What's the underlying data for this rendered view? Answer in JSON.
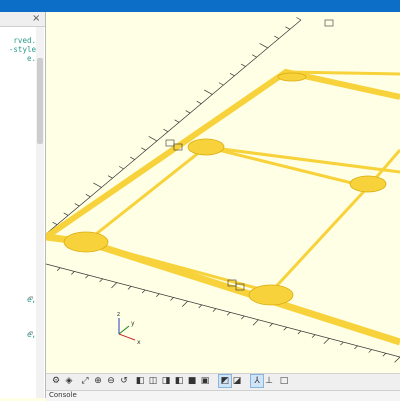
{
  "editor": {
    "close_glyph": "×",
    "lines": [
      {
        "text": "rved."
      },
      {
        "text": "-style"
      },
      {
        "text": "e."
      },
      {
        "text": "e,"
      },
      {
        "text": "e,"
      }
    ],
    "gutter_marks": [
      "⊖",
      "⊖"
    ]
  },
  "viewport": {
    "colors": {
      "background": "#ffffe5",
      "model": "#f7d23a",
      "model_edge": "#d9ac10",
      "axis_x": "#c42a2a",
      "axis_y": "#2a8a2a",
      "axis_z": "#2a3ac4",
      "ruler": "#333333"
    },
    "axis_labels": {
      "x": "x",
      "y": "y",
      "z": "z"
    }
  },
  "toolbar": {
    "buttons": [
      {
        "icon": "render-preview-icon",
        "glyph": "⚙"
      },
      {
        "icon": "render-icon",
        "glyph": "◈"
      },
      {
        "icon": "view-all-icon",
        "glyph": "⤢"
      },
      {
        "icon": "zoom-in-icon",
        "glyph": "⊕"
      },
      {
        "icon": "zoom-out-icon",
        "glyph": "⊖"
      },
      {
        "icon": "reset-view-icon",
        "glyph": "↺"
      },
      {
        "icon": "view-right-icon",
        "glyph": "◧"
      },
      {
        "icon": "view-top-icon",
        "glyph": "◫"
      },
      {
        "icon": "view-bottom-icon",
        "glyph": "◨"
      },
      {
        "icon": "view-left-icon",
        "glyph": "◧"
      },
      {
        "icon": "view-front-icon",
        "glyph": "■"
      },
      {
        "icon": "view-back-icon",
        "glyph": "▣"
      },
      {
        "icon": "perspective-icon",
        "glyph": "◩",
        "active": true
      },
      {
        "icon": "orthogonal-icon",
        "glyph": "◪"
      },
      {
        "icon": "show-axes-icon",
        "glyph": "⅄",
        "active": true
      },
      {
        "icon": "show-scale-icon",
        "glyph": "⊥"
      },
      {
        "icon": "show-edges-icon",
        "glyph": "□"
      }
    ]
  },
  "console": {
    "label": "Console"
  }
}
